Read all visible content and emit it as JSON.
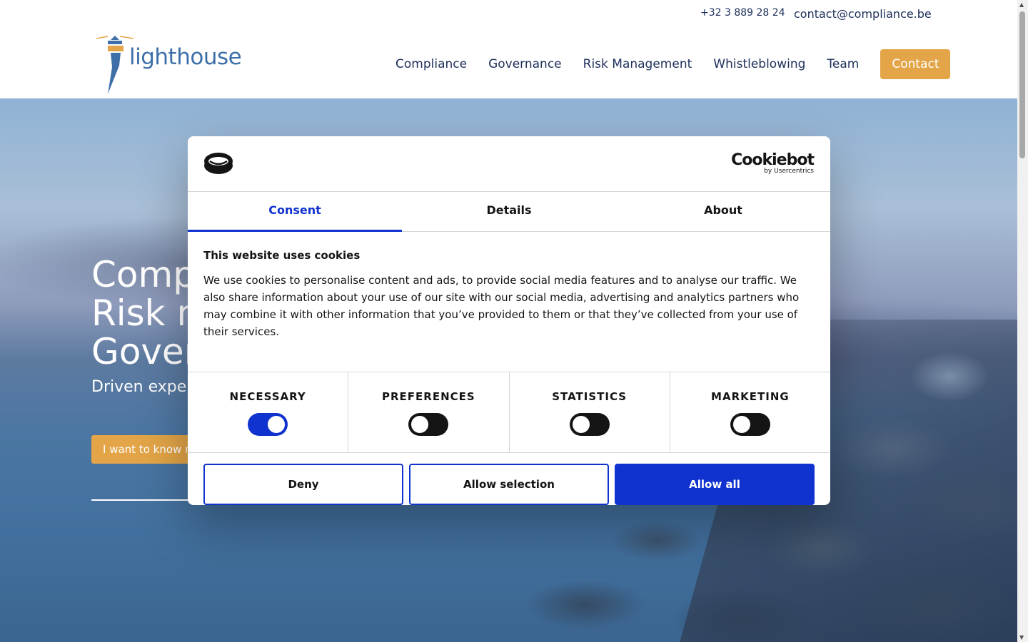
{
  "header": {
    "phone": "+32 3 889 28 24",
    "email": "contact@compliance.be",
    "logo_text": "lighthouse",
    "nav": [
      "Compliance",
      "Governance",
      "Risk Management",
      "Whistleblowing",
      "Team"
    ],
    "contact_label": "Contact"
  },
  "hero": {
    "title_lines": [
      "Comp",
      "Risk m",
      "Gover"
    ],
    "subtitle": "Driven expe",
    "cta_label": "I want to know m"
  },
  "cookie_dialog": {
    "brand": "Cookiebot",
    "brand_sub": "by Usercentrics",
    "tabs": [
      "Consent",
      "Details",
      "About"
    ],
    "active_tab": "Consent",
    "title": "This website uses cookies",
    "text": "We use cookies to personalise content and ads, to provide social media features and to analyse our traffic. We also share information about your use of our site with our social media, advertising and analytics partners who may combine it with other information that you’ve provided to them or that they’ve collected from your use of their services.",
    "categories": [
      {
        "label": "NECESSARY",
        "on": true
      },
      {
        "label": "PREFERENCES",
        "on": false
      },
      {
        "label": "STATISTICS",
        "on": false
      },
      {
        "label": "MARKETING",
        "on": false
      }
    ],
    "buttons": {
      "deny": "Deny",
      "allow_selection": "Allow selection",
      "allow_all": "Allow all"
    }
  },
  "colors": {
    "accent_orange": "#e3a547",
    "navy": "#1c2f5a",
    "cookiebot_blue": "#1032cf"
  }
}
